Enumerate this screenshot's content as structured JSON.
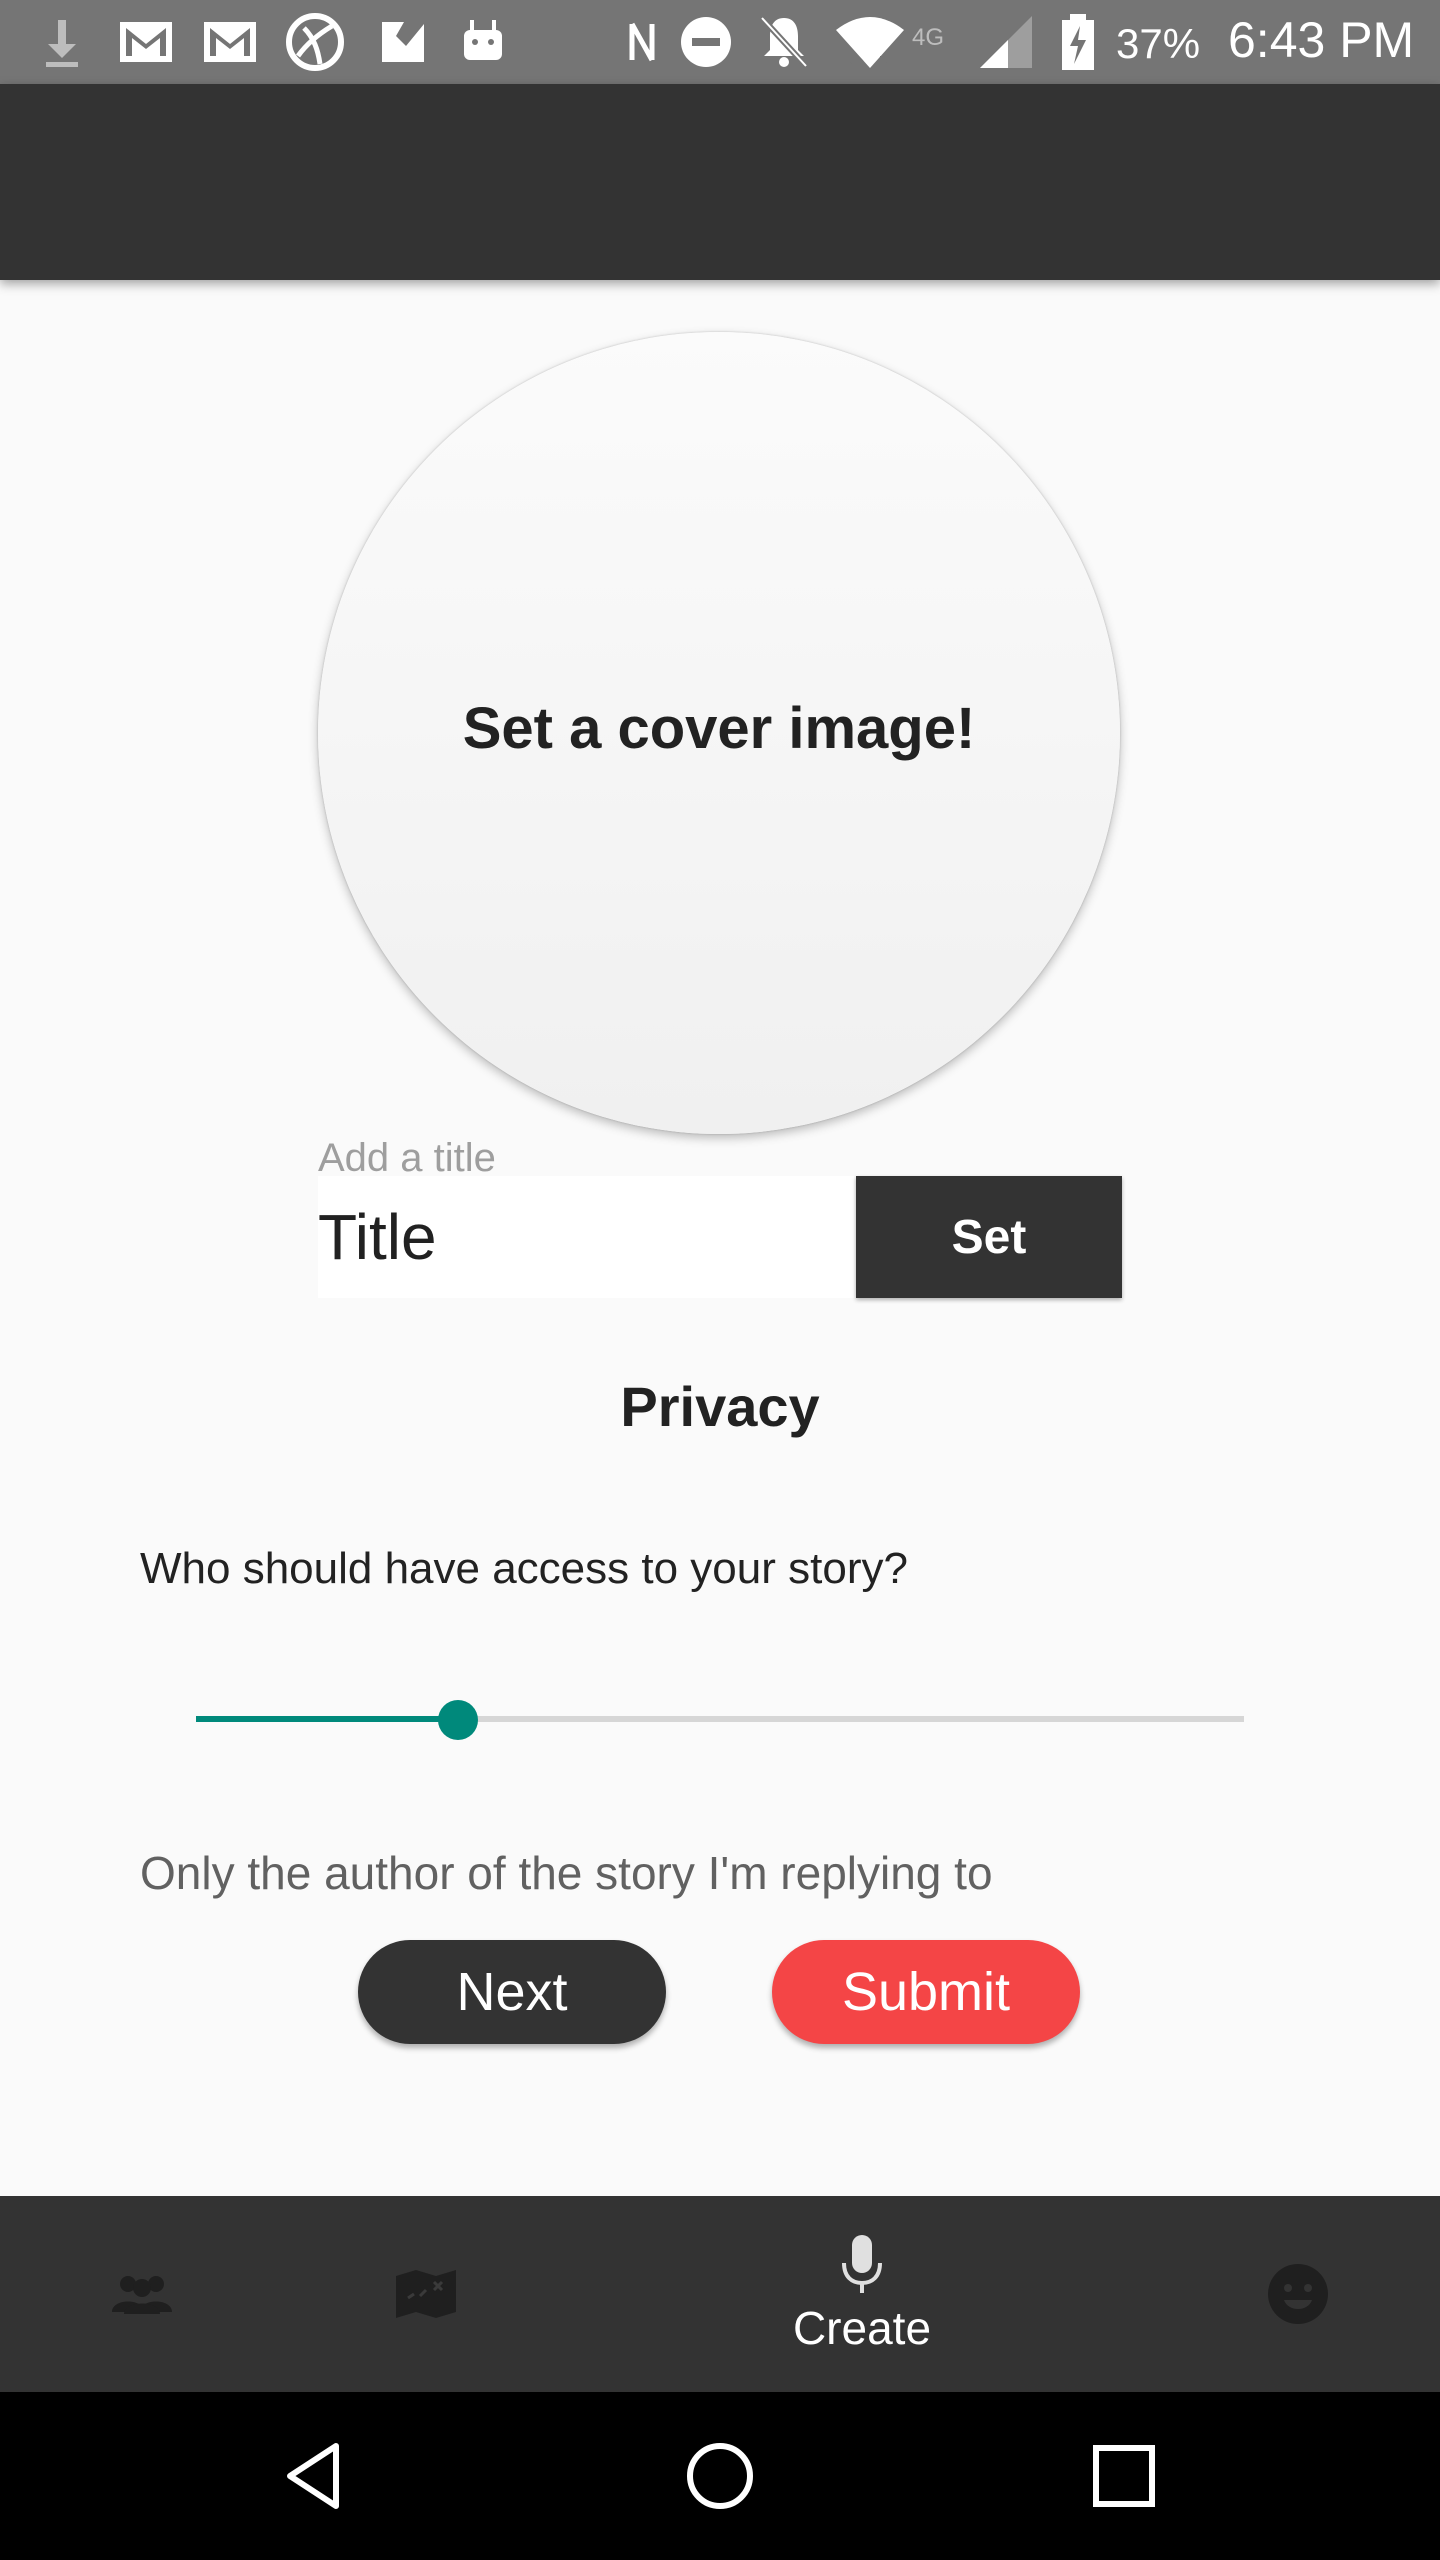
{
  "status_bar": {
    "battery": "37%",
    "time": "6:43 PM",
    "network_label": "4G",
    "icons": [
      "download-icon",
      "gmail-icon",
      "gmail-icon",
      "browser-icon",
      "check-icon",
      "android-icon",
      "nfc-icon",
      "do-not-disturb-icon",
      "notifications-off-icon",
      "wifi-icon",
      "signal-icon",
      "battery-charging-icon"
    ]
  },
  "cover": {
    "prompt": "Set a cover image!"
  },
  "title_field": {
    "hint": "Add a title",
    "value": "Title",
    "set_label": "Set"
  },
  "privacy": {
    "heading": "Privacy",
    "question": "Who should have access to your story?",
    "slider_value": 0.25,
    "description": "Only the author of the story I'm replying to"
  },
  "actions": {
    "next_label": "Next",
    "submit_label": "Submit"
  },
  "bottom_nav": {
    "items": [
      {
        "icon": "people-icon",
        "label": ""
      },
      {
        "icon": "map-icon",
        "label": ""
      },
      {
        "icon": "microphone-icon",
        "label": "Create"
      },
      {
        "icon": "smiley-icon",
        "label": ""
      }
    ]
  },
  "colors": {
    "bar_dark": "#333333",
    "accent_teal": "#00897b",
    "submit_red": "#f44546",
    "status_bar": "#757575"
  }
}
